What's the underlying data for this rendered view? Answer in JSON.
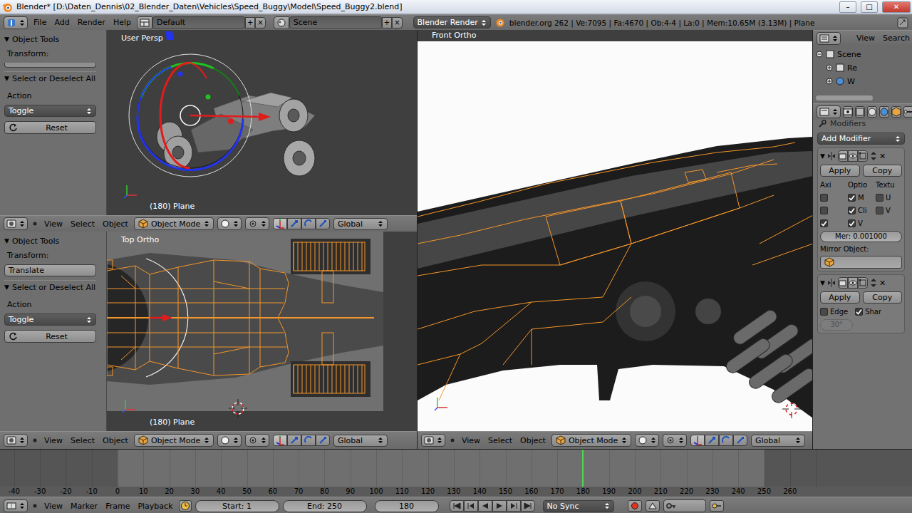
{
  "title_bar": {
    "title": "Blender* [D:\\Daten_Dennis\\02_Blender_Daten\\Vehicles\\Speed_Buggy\\Model\\Speed_Buggy2.blend]",
    "controls": [
      "–",
      "□",
      "✕"
    ]
  },
  "info_header": {
    "menus": [
      "File",
      "Add",
      "Render",
      "Help"
    ],
    "layout": "Default",
    "layout_buttons": [
      "+",
      "×"
    ],
    "scene": "Scene",
    "scene_buttons": [
      "+",
      "×"
    ],
    "engine": "Blender Render",
    "stats": "blender.org 262 | Ve:7095 | Fa:4670 | Ob:4-4 | La:0 | Mem:10.65M (3.13M) | Plane"
  },
  "tool_shelves": [
    {
      "collapse_icon": "▼",
      "panel_title": "Object Tools",
      "transform_label": "Transform:",
      "transform_buttons": [],
      "operator": {
        "collapse_icon": "▼",
        "title": "Select or Deselect All",
        "action_label": "Action",
        "action_value": "Toggle",
        "reset": "Reset"
      }
    },
    {
      "collapse_icon": "▼",
      "panel_title": "Object Tools",
      "transform_label": "Transform:",
      "transform_buttons": [
        "Translate"
      ],
      "operator": {
        "collapse_icon": "▼",
        "title": "Select or Deselect All",
        "action_label": "Action",
        "action_value": "Toggle",
        "reset": "Reset"
      }
    }
  ],
  "viewports": [
    {
      "label": "User Persp",
      "object": "(180) Plane",
      "header": {
        "menus": [
          "View",
          "Select",
          "Object"
        ],
        "mode": "Object Mode",
        "orientation": "Global"
      }
    },
    {
      "label": "Top Ortho",
      "object": "(180) Plane",
      "header": {
        "menus": [
          "View",
          "Select",
          "Object"
        ],
        "mode": "Object Mode",
        "orientation": "Global"
      }
    },
    {
      "label": "Front Ortho",
      "object": "",
      "header": {
        "menus": [
          "View",
          "Select",
          "Object"
        ],
        "mode": "Object Mode",
        "orientation": "Global"
      }
    }
  ],
  "outliner": {
    "menus": [
      "View",
      "Search"
    ],
    "items": [
      {
        "label": "Scene",
        "expanded": true
      },
      {
        "label": "Re",
        "expanded": false
      },
      {
        "label": "W",
        "expanded": false
      }
    ]
  },
  "properties": {
    "section": "Modifiers",
    "add_modifier": "Add Modifier",
    "modifiers": [
      {
        "kind": "mirror",
        "collapse_icon": "▼",
        "close": "✕",
        "apply": "Apply",
        "copy": "Copy",
        "columns": [
          "Axi",
          "Optio",
          "Textu"
        ],
        "checks": [
          {
            "label": "",
            "checked": false
          },
          {
            "label": "M",
            "checked": true
          },
          {
            "label": "U",
            "checked": false
          },
          {
            "label": "",
            "checked": false
          },
          {
            "label": "Cli",
            "checked": true
          },
          {
            "label": "V",
            "checked": false
          },
          {
            "label": "",
            "checked": true
          },
          {
            "label": "V",
            "checked": true
          }
        ],
        "merge": "Mer: 0.001000",
        "mirror_object_label": "Mirror Object:"
      },
      {
        "kind": "edge_split",
        "collapse_icon": "▼",
        "close": "✕",
        "apply": "Apply",
        "copy": "Copy",
        "checks": [
          {
            "label": "Edge",
            "checked": false
          },
          {
            "label": "Shar",
            "checked": true
          }
        ],
        "angle": "30°",
        "angle_disabled": true
      }
    ]
  },
  "timeline": {
    "ruler": [
      "-40",
      "-30",
      "-20",
      "-10",
      "0",
      "10",
      "20",
      "30",
      "40",
      "50",
      "60",
      "70",
      "80",
      "90",
      "100",
      "110",
      "120",
      "130",
      "140",
      "150",
      "160",
      "170",
      "180",
      "190",
      "200",
      "210",
      "220",
      "230",
      "240",
      "250",
      "260"
    ],
    "frame_start": 1,
    "frame_end": 250,
    "frame_current": 180,
    "header": {
      "menus": [
        "View",
        "Marker",
        "Frame",
        "Playback"
      ],
      "start": "Start: 1",
      "end": "End: 250",
      "frame": "180",
      "sync": "No Sync"
    }
  }
}
